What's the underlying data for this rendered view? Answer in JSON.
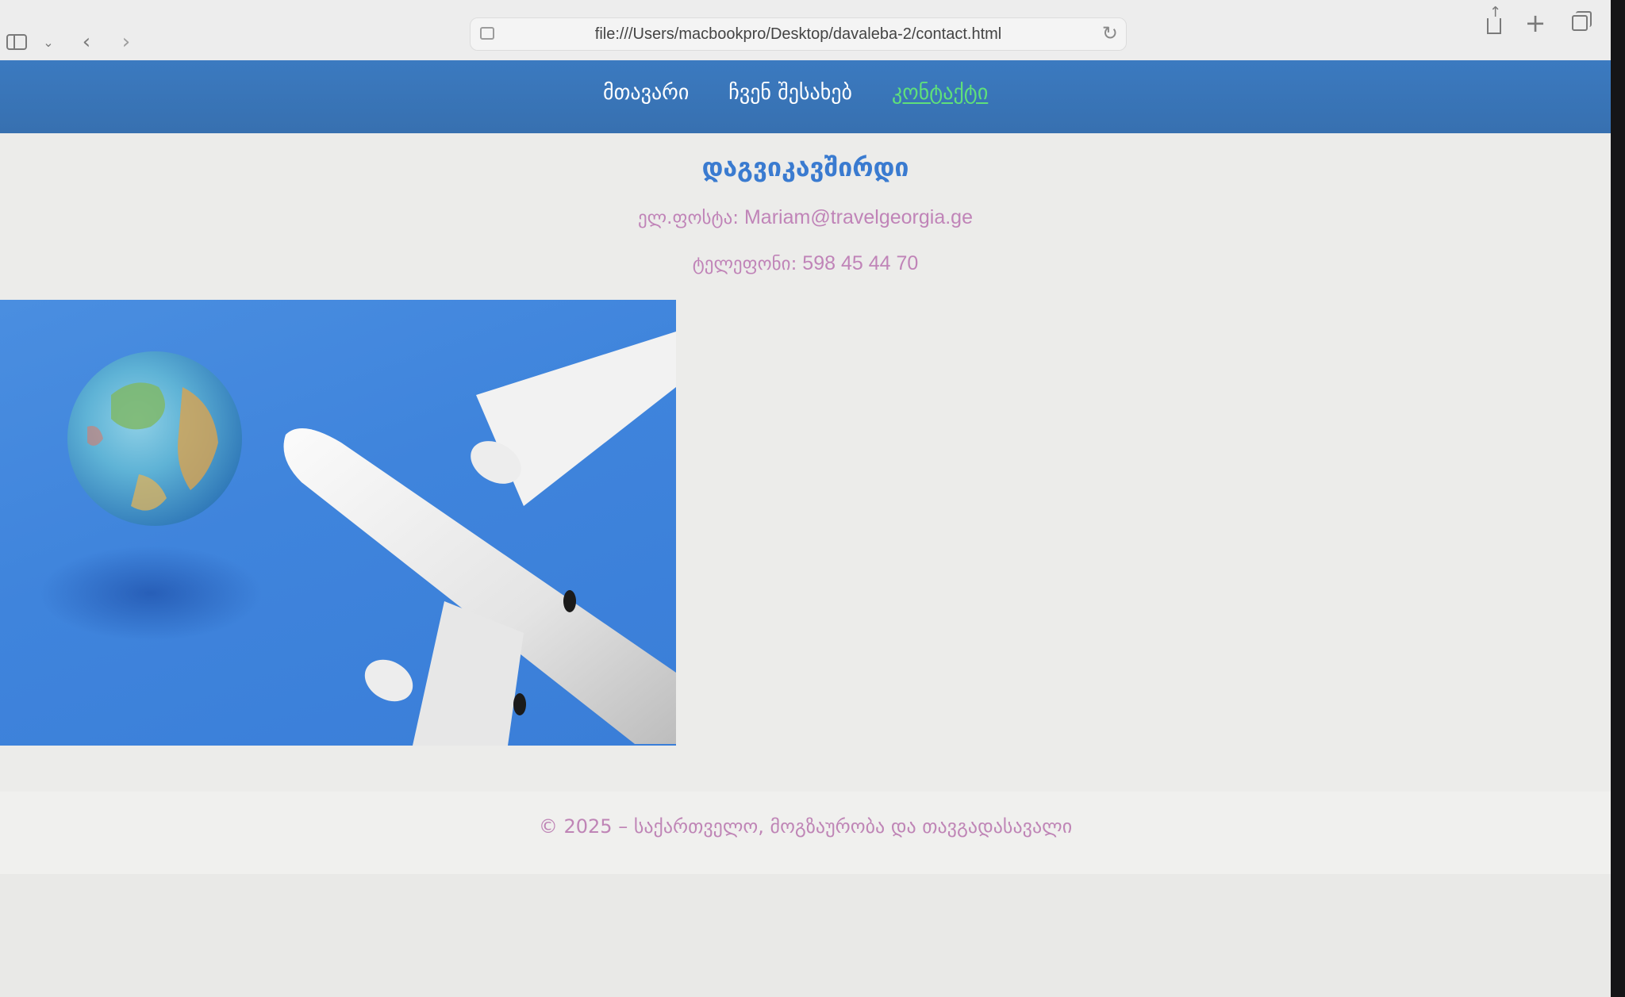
{
  "browser": {
    "url": "file:///Users/macbookpro/Desktop/davaleba-2/contact.html",
    "sidebar_icon": "sidebar-icon",
    "back_icon": "chevron-left-icon",
    "forward_icon": "chevron-right-icon",
    "reload_icon": "reload-icon",
    "share_icon": "share-icon",
    "new_tab_icon": "plus-icon",
    "tabs_icon": "tab-overview-icon"
  },
  "nav": {
    "items": [
      {
        "label": "მთავარი",
        "active": false
      },
      {
        "label": "ჩვენ შესახებ",
        "active": false
      },
      {
        "label": "კონტაქტი",
        "active": true
      }
    ]
  },
  "contact": {
    "heading": "დაგვიკავშირდი",
    "email_label": "ელ.ფოსტა:",
    "email_value": "Mariam@travelgeorgia.ge",
    "phone_label": "ტელეფონი:",
    "phone_value": "598 45 44 70"
  },
  "footer": {
    "text": "© 2025 – საქართველო, მოგზაურობა და თავგადასავალი"
  },
  "colors": {
    "nav_bg": "#3770b0",
    "nav_active": "#5fe07a",
    "heading": "#3a7bd0",
    "contact_text": "#c084b8",
    "image_bg": "#3f84dc"
  }
}
